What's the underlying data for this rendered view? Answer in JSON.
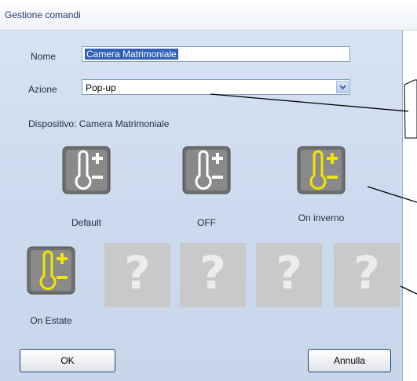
{
  "window": {
    "title": "Gestione comandi"
  },
  "form": {
    "nome_label": "Nome",
    "nome_value": "Camera Matrimoniale",
    "azione_label": "Azione",
    "azione_value": "Pop-up",
    "dispositivo_text": "Dispositivo: Camera Matrimoniale"
  },
  "commands": [
    {
      "label": "Default",
      "icon": "thermostat-icon",
      "state": "gray"
    },
    {
      "label": "OFF",
      "icon": "thermostat-icon",
      "state": "gray"
    },
    {
      "label": "On inverno",
      "icon": "thermostat-icon",
      "state": "yellow"
    },
    {
      "label": "On Estate",
      "icon": "thermostat-icon",
      "state": "yellow"
    }
  ],
  "placeholders": [
    "?",
    "?",
    "?",
    "?"
  ],
  "buttons": {
    "ok": "OK",
    "cancel": "Annulla"
  },
  "colors": {
    "panel": "#cddbee",
    "accent_yellow": "#f2e600",
    "selection": "#2f5fb8"
  }
}
